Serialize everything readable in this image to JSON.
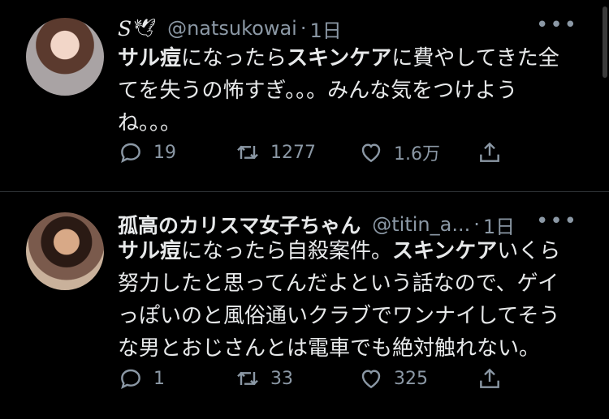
{
  "tweets": [
    {
      "name": "S",
      "name_emoji": "🕊",
      "handle": "@natsukowai",
      "separator": "·",
      "time": "1日",
      "more": "•••",
      "text_parts": [
        {
          "t": "サル痘",
          "bold": true
        },
        {
          "t": "になったら",
          "bold": false
        },
        {
          "t": "スキンケア",
          "bold": true
        },
        {
          "t": "に費やしてきた全\nてを失うの怖すぎ。。。みんな気をつけよう\nね。。。",
          "bold": false
        }
      ],
      "replies": "19",
      "retweets": "1277",
      "likes": "1.6万"
    },
    {
      "name": "孤高のカリスマ女子ちゃん",
      "handle": "@titin_a...",
      "separator": "·",
      "time": "1日",
      "more": "•••",
      "text_parts": [
        {
          "t": "サル痘",
          "bold": true
        },
        {
          "t": "になったら自殺案件。",
          "bold": false
        },
        {
          "t": "スキンケア",
          "bold": true
        },
        {
          "t": "いくら\n努力したと思ってんだよという話なので、ゲイ\nっぽいのと風俗通いクラブでワンナイしてそう\nな男とおじさんとは電車でも絶対触れない。",
          "bold": false
        }
      ],
      "replies": "1",
      "retweets": "33",
      "likes": "325"
    }
  ],
  "icons": [
    "reply-icon",
    "retweet-icon",
    "like-icon",
    "share-icon",
    "more-icon"
  ],
  "colors": {
    "background": "#000000",
    "text": "#e7e9ea",
    "muted": "#8b98a5",
    "divider": "#2f3336"
  }
}
